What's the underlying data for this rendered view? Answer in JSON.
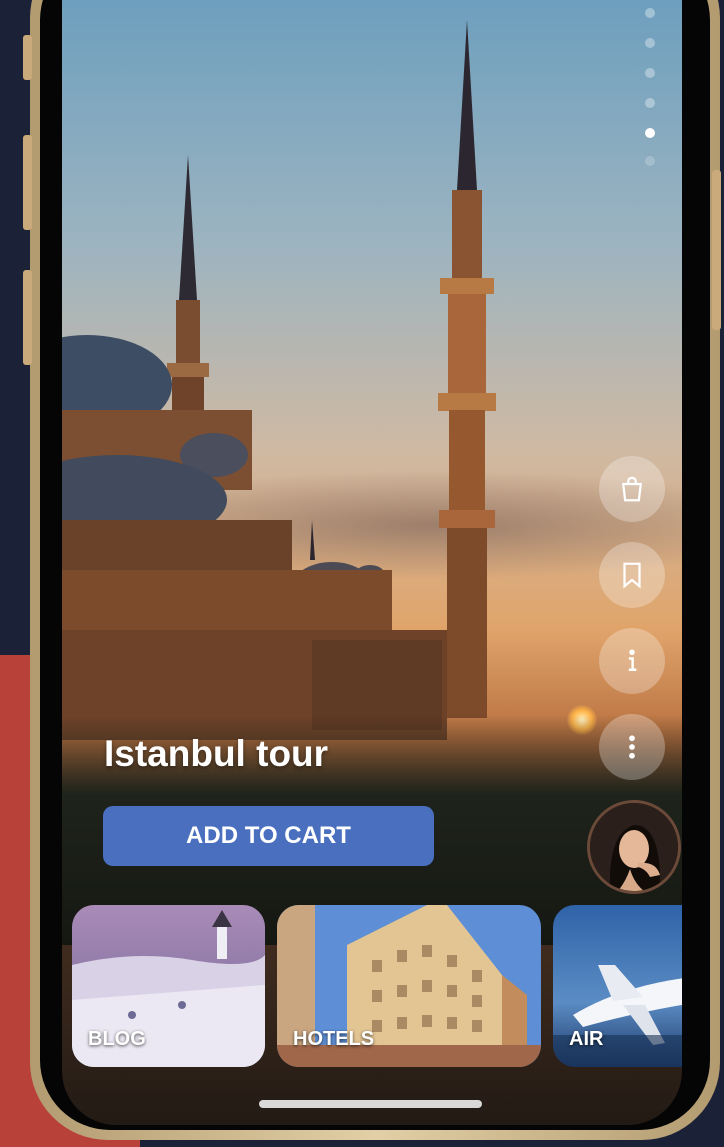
{
  "screen": {
    "slides_total": 6,
    "active_slide": 5
  },
  "tour": {
    "title": "Istanbul tour",
    "cta_label": "ADD TO CART"
  },
  "actions": [
    {
      "icon": "shopping-bag-icon"
    },
    {
      "icon": "bookmark-icon"
    },
    {
      "icon": "info-icon"
    },
    {
      "icon": "more-vertical-icon"
    }
  ],
  "categories": [
    {
      "label": "BLOG"
    },
    {
      "label": "HOTELS"
    },
    {
      "label": "AIR"
    }
  ],
  "colors": {
    "cta": "#4a6fbe",
    "frame": "#d6c39b"
  }
}
